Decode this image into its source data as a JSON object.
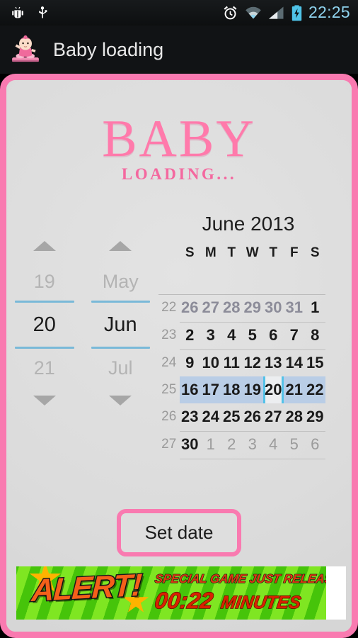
{
  "statusbar": {
    "icons": [
      "android-debug-icon",
      "usb-icon",
      "alarm-icon",
      "wifi-icon",
      "signal-icon",
      "battery-charging-icon"
    ],
    "clock": "22:25"
  },
  "titlebar": {
    "app_icon": "baby-on-scale-icon",
    "title": "Baby loading"
  },
  "logo": {
    "main": "BABY",
    "sub": "LOADING...",
    "color": "#ff7aab"
  },
  "spinners": {
    "day": {
      "up_icon": "arrow-up-icon",
      "down_icon": "arrow-down-icon",
      "previous": "19",
      "selected": "20",
      "next": "21"
    },
    "month": {
      "up_icon": "arrow-up-icon",
      "down_icon": "arrow-down-icon",
      "previous": "May",
      "selected": "Jun",
      "next": "Jul"
    }
  },
  "calendar": {
    "title": "June 2013",
    "weekday_headers": [
      "S",
      "M",
      "T",
      "W",
      "T",
      "F",
      "S"
    ],
    "selected_day": "20",
    "selected_week": "25",
    "highlight_color": "#b9cde6",
    "cursor_color": "#53c2e8",
    "weeks": [
      {
        "week": "22",
        "days": [
          {
            "label": "26",
            "type": "adj"
          },
          {
            "label": "27",
            "type": "adj"
          },
          {
            "label": "28",
            "type": "adj"
          },
          {
            "label": "29",
            "type": "adj"
          },
          {
            "label": "30",
            "type": "adj"
          },
          {
            "label": "31",
            "type": "adj"
          },
          {
            "label": "1",
            "type": "cur"
          }
        ]
      },
      {
        "week": "23",
        "days": [
          {
            "label": "2",
            "type": "cur"
          },
          {
            "label": "3",
            "type": "cur"
          },
          {
            "label": "4",
            "type": "cur"
          },
          {
            "label": "5",
            "type": "cur"
          },
          {
            "label": "6",
            "type": "cur"
          },
          {
            "label": "7",
            "type": "cur"
          },
          {
            "label": "8",
            "type": "cur"
          }
        ]
      },
      {
        "week": "24",
        "days": [
          {
            "label": "9",
            "type": "cur"
          },
          {
            "label": "10",
            "type": "cur"
          },
          {
            "label": "11",
            "type": "cur"
          },
          {
            "label": "12",
            "type": "cur"
          },
          {
            "label": "13",
            "type": "cur"
          },
          {
            "label": "14",
            "type": "cur"
          },
          {
            "label": "15",
            "type": "cur"
          }
        ]
      },
      {
        "week": "25",
        "selected": true,
        "days": [
          {
            "label": "16",
            "type": "cur"
          },
          {
            "label": "17",
            "type": "cur"
          },
          {
            "label": "18",
            "type": "cur"
          },
          {
            "label": "19",
            "type": "cur"
          },
          {
            "label": "20",
            "type": "cur",
            "selected": true
          },
          {
            "label": "21",
            "type": "cur"
          },
          {
            "label": "22",
            "type": "cur"
          }
        ]
      },
      {
        "week": "26",
        "days": [
          {
            "label": "23",
            "type": "cur"
          },
          {
            "label": "24",
            "type": "cur"
          },
          {
            "label": "25",
            "type": "cur"
          },
          {
            "label": "26",
            "type": "cur"
          },
          {
            "label": "27",
            "type": "cur"
          },
          {
            "label": "28",
            "type": "cur"
          },
          {
            "label": "29",
            "type": "cur"
          }
        ]
      },
      {
        "week": "27",
        "days": [
          {
            "label": "30",
            "type": "cur"
          },
          {
            "label": "1",
            "type": "adj-next"
          },
          {
            "label": "2",
            "type": "adj-next"
          },
          {
            "label": "3",
            "type": "adj-next"
          },
          {
            "label": "4",
            "type": "adj-next"
          },
          {
            "label": "5",
            "type": "adj-next"
          },
          {
            "label": "6",
            "type": "adj-next"
          }
        ]
      }
    ]
  },
  "actions": {
    "set_date_label": "Set date",
    "button_border_color": "#f97ab0"
  },
  "ad": {
    "headline": "ALERT!",
    "line1": "SPECIAL GAME JUST RELEASED FREE FOR",
    "timer": "00:22",
    "timer_unit": "MINUTES"
  }
}
